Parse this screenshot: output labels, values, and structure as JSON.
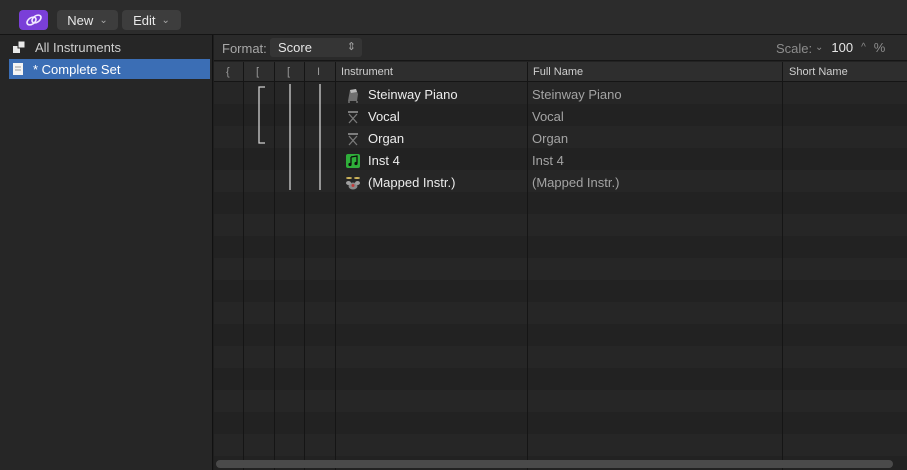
{
  "toolbar": {
    "link_icon": "link-icon",
    "new_label": "New",
    "edit_label": "Edit",
    "chevron": "⌄"
  },
  "sidebar": {
    "items": [
      {
        "label": "All Instruments",
        "icon": "instruments-folder-icon",
        "selected": false
      },
      {
        "label": "* Complete Set",
        "icon": "document-icon",
        "selected": true
      }
    ]
  },
  "format_bar": {
    "format_label": "Format:",
    "format_value": "Score",
    "scale_label": "Scale:",
    "scale_value": "100",
    "scale_unit": "%"
  },
  "table": {
    "headers": {
      "brace": "{",
      "bracket": "[",
      "sub_bracket": "[",
      "barline": "I",
      "instrument": "Instrument",
      "full_name": "Full Name",
      "short_name": "Short Name"
    },
    "rows": [
      {
        "instrument": "Steinway Piano",
        "full_name": "Steinway Piano",
        "icon": "piano-icon"
      },
      {
        "instrument": "Vocal",
        "full_name": "Vocal",
        "icon": "notation-icon"
      },
      {
        "instrument": "Organ",
        "full_name": "Organ",
        "icon": "notation-icon"
      },
      {
        "instrument": "Inst 4",
        "full_name": "Inst 4",
        "icon": "music-note-icon"
      },
      {
        "instrument": "(Mapped Instr.)",
        "full_name": "(Mapped Instr.)",
        "icon": "drum-kit-icon"
      }
    ]
  },
  "colors": {
    "accent": "#7a3fd8",
    "selection": "#3b6eb5",
    "inst4_icon": "#2fae3a"
  }
}
